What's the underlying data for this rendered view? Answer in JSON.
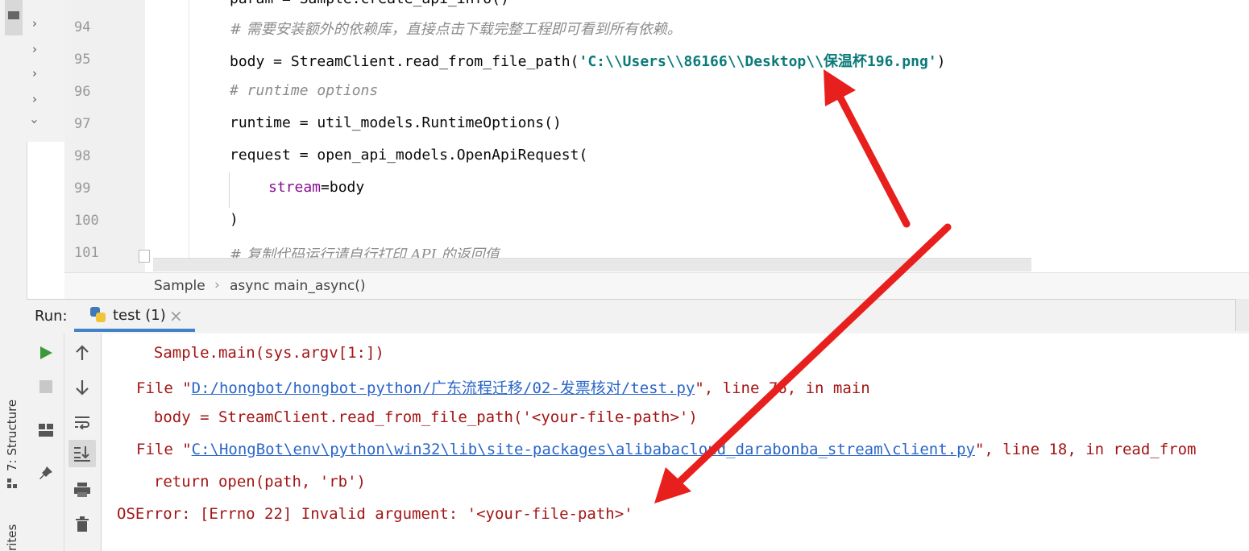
{
  "left_strip": {
    "structure_label": "7: Structure",
    "favorites_label": "rites"
  },
  "editor": {
    "lines": [
      {
        "num": "94",
        "text": "# 需要安装额外的依赖库，直接点击下载完整工程即可看到所有依赖。",
        "kind": "comment"
      },
      {
        "num": "95",
        "text_pre": "body = StreamClient.read_from_file_path(",
        "text_str": "'C:\\\\Users\\\\86166\\\\Desktop\\\\保温杯196.png'",
        "text_post": ")",
        "kind": "code-str"
      },
      {
        "num": "96",
        "text": "# runtime options",
        "kind": "comment"
      },
      {
        "num": "97",
        "text": "runtime = util_models.RuntimeOptions()",
        "kind": "code"
      },
      {
        "num": "98",
        "text": "request = open_api_models.OpenApiRequest(",
        "kind": "code"
      },
      {
        "num": "99",
        "kw": "stream",
        "rest": "=body",
        "kind": "kwarg"
      },
      {
        "num": "100",
        "text": ")",
        "kind": "code"
      },
      {
        "num": "101",
        "text": "# 复制代码运行请自行打印 API 的返回值",
        "kind": "comment"
      }
    ]
  },
  "breadcrumb": {
    "class_name": "Sample",
    "separator": "›",
    "method": "async main_async()"
  },
  "run_panel": {
    "run_label": "Run:",
    "tab_label": "test (1)",
    "tab_close": "×",
    "console": {
      "line1": "  Sample.main(sys.argv[1:])",
      "line2_pre": "File \"",
      "line2_link": "D:/hongbot/hongbot-python/广东流程迁移/02-发票核对/test.py",
      "line2_post": "\", line 76, in main",
      "line3": "  body = StreamClient.read_from_file_path('<your-file-path>')",
      "line4_pre": "File \"",
      "line4_link": "C:\\HongBot\\env\\python\\win32\\lib\\site-packages\\alibabacloud_darabonba_stream\\client.py",
      "line4_post": "\", line 18, in read_from",
      "line5": "  return open(path, 'rb')",
      "line6": "OSError: [Errno 22] Invalid argument: '<your-file-path>'"
    }
  },
  "colors": {
    "arrow": "#e8201d",
    "link": "#2a66c8",
    "error": "#a31515",
    "string": "#067d17",
    "accent": "#4083c9"
  }
}
